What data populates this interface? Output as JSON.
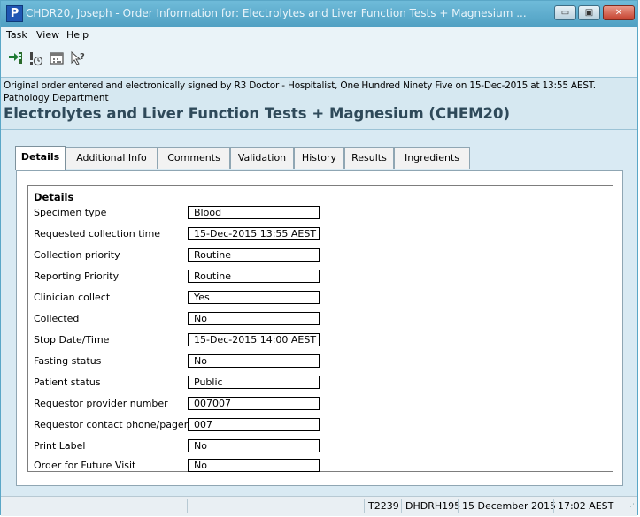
{
  "window": {
    "app_icon_letter": "P",
    "title": "CHDR20, Joseph - Order Information for:  Electrolytes and Liver Function Tests + Magnesium ...",
    "minimize_glyph": "▭",
    "maximize_glyph": "▣",
    "close_glyph": "✕"
  },
  "menu": {
    "items": [
      {
        "label": "Task"
      },
      {
        "label": "View"
      },
      {
        "label": "Help"
      }
    ]
  },
  "toolbar": {
    "icons": [
      "print-order-icon",
      "alert-clock-icon",
      "calendar-icon",
      "help-pointer-icon"
    ]
  },
  "order_info": {
    "signed_line": "Original order entered and electronically signed by R3 Doctor - Hospitalist, One Hundred Ninety Five on 15-Dec-2015 at 13:55 AEST.",
    "department": "Pathology Department",
    "order_title": "Electrolytes and Liver Function Tests + Magnesium (CHEM20)"
  },
  "tabs": [
    {
      "label": "Details",
      "active": true
    },
    {
      "label": "Additional Info",
      "active": false
    },
    {
      "label": "Comments",
      "active": false
    },
    {
      "label": "Validation",
      "active": false
    },
    {
      "label": "History",
      "active": false
    },
    {
      "label": "Results",
      "active": false
    },
    {
      "label": "Ingredients",
      "active": false
    }
  ],
  "details": {
    "group_title": "Details",
    "fields": [
      {
        "label": "Specimen type",
        "value": "Blood"
      },
      {
        "label": "Requested collection time",
        "value": "15-Dec-2015 13:55 AEST"
      },
      {
        "label": "Collection priority",
        "value": "Routine"
      },
      {
        "label": "Reporting Priority",
        "value": "Routine"
      },
      {
        "label": "Clinician collect",
        "value": "Yes"
      },
      {
        "label": "Collected",
        "value": "No"
      },
      {
        "label": "Stop Date/Time",
        "value": "15-Dec-2015 14:00 AEST"
      },
      {
        "label": "Fasting status",
        "value": "No"
      },
      {
        "label": "Patient status",
        "value": "Public"
      },
      {
        "label": "Requestor provider number",
        "value": "007007"
      },
      {
        "label": "Requestor contact phone/pager",
        "value": "007"
      },
      {
        "label": "Print Label",
        "value": "No"
      },
      {
        "label": "Order for Future Visit",
        "value": "No"
      }
    ]
  },
  "status_bar": {
    "cells": [
      "T2239",
      "DHDRH195",
      "15 December  2015",
      "17:02 AEST"
    ]
  }
}
